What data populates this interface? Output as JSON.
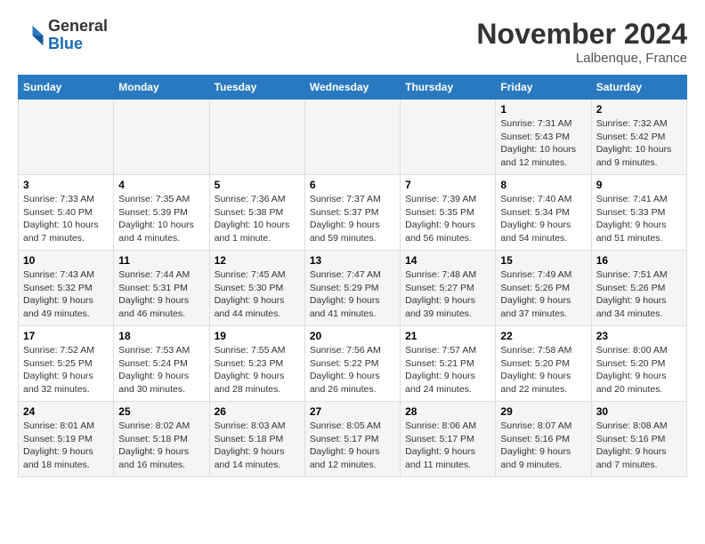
{
  "header": {
    "logo_line1": "General",
    "logo_line2": "Blue",
    "month_title": "November 2024",
    "location": "Lalbenque, France"
  },
  "weekdays": [
    "Sunday",
    "Monday",
    "Tuesday",
    "Wednesday",
    "Thursday",
    "Friday",
    "Saturday"
  ],
  "weeks": [
    [
      {
        "day": "",
        "info": ""
      },
      {
        "day": "",
        "info": ""
      },
      {
        "day": "",
        "info": ""
      },
      {
        "day": "",
        "info": ""
      },
      {
        "day": "",
        "info": ""
      },
      {
        "day": "1",
        "info": "Sunrise: 7:31 AM\nSunset: 5:43 PM\nDaylight: 10 hours and 12 minutes."
      },
      {
        "day": "2",
        "info": "Sunrise: 7:32 AM\nSunset: 5:42 PM\nDaylight: 10 hours and 9 minutes."
      }
    ],
    [
      {
        "day": "3",
        "info": "Sunrise: 7:33 AM\nSunset: 5:40 PM\nDaylight: 10 hours and 7 minutes."
      },
      {
        "day": "4",
        "info": "Sunrise: 7:35 AM\nSunset: 5:39 PM\nDaylight: 10 hours and 4 minutes."
      },
      {
        "day": "5",
        "info": "Sunrise: 7:36 AM\nSunset: 5:38 PM\nDaylight: 10 hours and 1 minute."
      },
      {
        "day": "6",
        "info": "Sunrise: 7:37 AM\nSunset: 5:37 PM\nDaylight: 9 hours and 59 minutes."
      },
      {
        "day": "7",
        "info": "Sunrise: 7:39 AM\nSunset: 5:35 PM\nDaylight: 9 hours and 56 minutes."
      },
      {
        "day": "8",
        "info": "Sunrise: 7:40 AM\nSunset: 5:34 PM\nDaylight: 9 hours and 54 minutes."
      },
      {
        "day": "9",
        "info": "Sunrise: 7:41 AM\nSunset: 5:33 PM\nDaylight: 9 hours and 51 minutes."
      }
    ],
    [
      {
        "day": "10",
        "info": "Sunrise: 7:43 AM\nSunset: 5:32 PM\nDaylight: 9 hours and 49 minutes."
      },
      {
        "day": "11",
        "info": "Sunrise: 7:44 AM\nSunset: 5:31 PM\nDaylight: 9 hours and 46 minutes."
      },
      {
        "day": "12",
        "info": "Sunrise: 7:45 AM\nSunset: 5:30 PM\nDaylight: 9 hours and 44 minutes."
      },
      {
        "day": "13",
        "info": "Sunrise: 7:47 AM\nSunset: 5:29 PM\nDaylight: 9 hours and 41 minutes."
      },
      {
        "day": "14",
        "info": "Sunrise: 7:48 AM\nSunset: 5:27 PM\nDaylight: 9 hours and 39 minutes."
      },
      {
        "day": "15",
        "info": "Sunrise: 7:49 AM\nSunset: 5:26 PM\nDaylight: 9 hours and 37 minutes."
      },
      {
        "day": "16",
        "info": "Sunrise: 7:51 AM\nSunset: 5:26 PM\nDaylight: 9 hours and 34 minutes."
      }
    ],
    [
      {
        "day": "17",
        "info": "Sunrise: 7:52 AM\nSunset: 5:25 PM\nDaylight: 9 hours and 32 minutes."
      },
      {
        "day": "18",
        "info": "Sunrise: 7:53 AM\nSunset: 5:24 PM\nDaylight: 9 hours and 30 minutes."
      },
      {
        "day": "19",
        "info": "Sunrise: 7:55 AM\nSunset: 5:23 PM\nDaylight: 9 hours and 28 minutes."
      },
      {
        "day": "20",
        "info": "Sunrise: 7:56 AM\nSunset: 5:22 PM\nDaylight: 9 hours and 26 minutes."
      },
      {
        "day": "21",
        "info": "Sunrise: 7:57 AM\nSunset: 5:21 PM\nDaylight: 9 hours and 24 minutes."
      },
      {
        "day": "22",
        "info": "Sunrise: 7:58 AM\nSunset: 5:20 PM\nDaylight: 9 hours and 22 minutes."
      },
      {
        "day": "23",
        "info": "Sunrise: 8:00 AM\nSunset: 5:20 PM\nDaylight: 9 hours and 20 minutes."
      }
    ],
    [
      {
        "day": "24",
        "info": "Sunrise: 8:01 AM\nSunset: 5:19 PM\nDaylight: 9 hours and 18 minutes."
      },
      {
        "day": "25",
        "info": "Sunrise: 8:02 AM\nSunset: 5:18 PM\nDaylight: 9 hours and 16 minutes."
      },
      {
        "day": "26",
        "info": "Sunrise: 8:03 AM\nSunset: 5:18 PM\nDaylight: 9 hours and 14 minutes."
      },
      {
        "day": "27",
        "info": "Sunrise: 8:05 AM\nSunset: 5:17 PM\nDaylight: 9 hours and 12 minutes."
      },
      {
        "day": "28",
        "info": "Sunrise: 8:06 AM\nSunset: 5:17 PM\nDaylight: 9 hours and 11 minutes."
      },
      {
        "day": "29",
        "info": "Sunrise: 8:07 AM\nSunset: 5:16 PM\nDaylight: 9 hours and 9 minutes."
      },
      {
        "day": "30",
        "info": "Sunrise: 8:08 AM\nSunset: 5:16 PM\nDaylight: 9 hours and 7 minutes."
      }
    ]
  ]
}
